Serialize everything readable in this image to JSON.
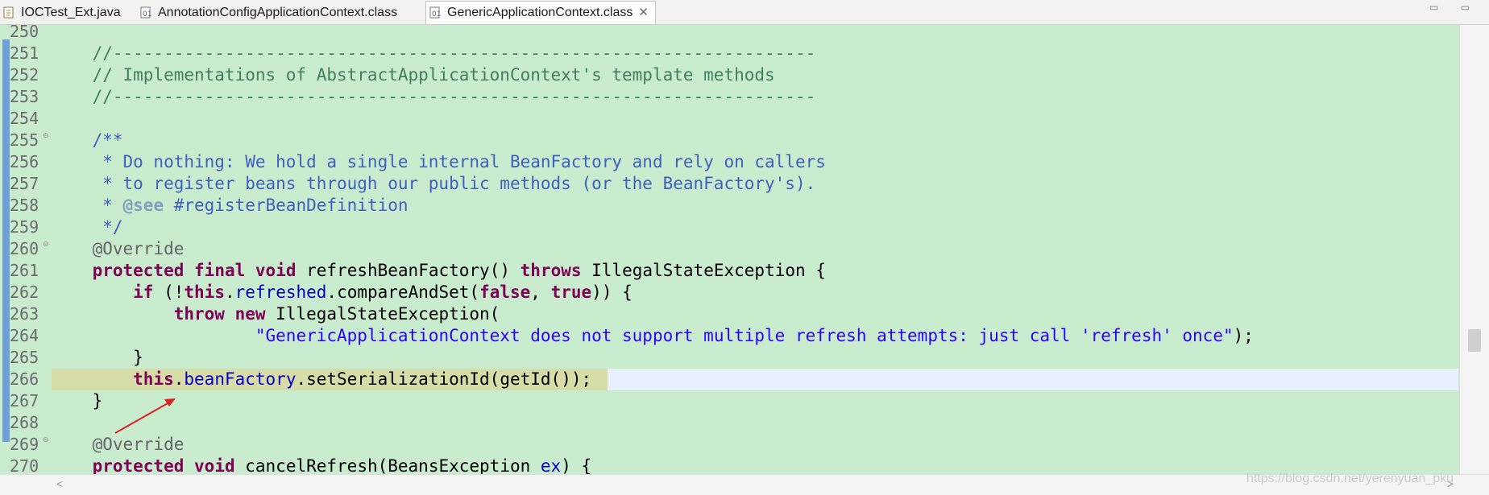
{
  "tabs": [
    {
      "label": "IOCTest_Ext.java",
      "icon": "java-file-icon",
      "active": false
    },
    {
      "label": "AnnotationConfigApplicationContext.class",
      "icon": "class-file-icon",
      "active": false
    },
    {
      "label": "GenericApplicationContext.class",
      "icon": "class-file-icon",
      "active": true,
      "close": "✕"
    }
  ],
  "window_buttons": "▭ ▭",
  "editor": {
    "line_numbers": [
      "250",
      "251",
      "252",
      "253",
      "254",
      "255",
      "256",
      "257",
      "258",
      "259",
      "260",
      "261",
      "262",
      "263",
      "264",
      "265",
      "266",
      "267",
      "268",
      "269",
      "270"
    ],
    "current_line": "266",
    "highlighted_text": "this.beanFactory.setSerializationId(getId());",
    "background_color": "#c9eccf",
    "code_lines": [
      {
        "n": "250",
        "tokens": []
      },
      {
        "n": "251",
        "tokens": [
          {
            "t": "    //---------------------------------------------------------------------",
            "c": "comment"
          }
        ]
      },
      {
        "n": "252",
        "tokens": [
          {
            "t": "    // Implementations of AbstractApplicationContext's template methods",
            "c": "comment"
          }
        ]
      },
      {
        "n": "253",
        "tokens": [
          {
            "t": "    //---------------------------------------------------------------------",
            "c": "comment"
          }
        ]
      },
      {
        "n": "254",
        "tokens": []
      },
      {
        "n": "255",
        "tokens": [
          {
            "t": "    /**",
            "c": "doc"
          }
        ]
      },
      {
        "n": "256",
        "tokens": [
          {
            "t": "     * Do nothing: We hold a single internal BeanFactory and rely on callers",
            "c": "doc"
          }
        ]
      },
      {
        "n": "257",
        "tokens": [
          {
            "t": "     * to register beans through our public methods (or the BeanFactory's).",
            "c": "doc"
          }
        ]
      },
      {
        "n": "258",
        "tokens": [
          {
            "t": "     * ",
            "c": "doc"
          },
          {
            "t": "@see",
            "c": "tag"
          },
          {
            "t": " #registerBeanDefinition",
            "c": "doc"
          }
        ]
      },
      {
        "n": "259",
        "tokens": [
          {
            "t": "     */",
            "c": "doc"
          }
        ]
      },
      {
        "n": "260",
        "tokens": [
          {
            "t": "    @Override",
            "c": "ann"
          }
        ]
      },
      {
        "n": "261",
        "tokens": [
          {
            "t": "    ",
            "c": ""
          },
          {
            "t": "protected",
            "c": "kw"
          },
          {
            "t": " ",
            "c": ""
          },
          {
            "t": "final",
            "c": "kw"
          },
          {
            "t": " ",
            "c": ""
          },
          {
            "t": "void",
            "c": "kw"
          },
          {
            "t": " refreshBeanFactory() ",
            "c": ""
          },
          {
            "t": "throws",
            "c": "kw"
          },
          {
            "t": " IllegalStateException {",
            "c": ""
          }
        ]
      },
      {
        "n": "262",
        "tokens": [
          {
            "t": "        ",
            "c": ""
          },
          {
            "t": "if",
            "c": "kw"
          },
          {
            "t": " (!",
            "c": ""
          },
          {
            "t": "this",
            "c": "kw"
          },
          {
            "t": ".",
            "c": ""
          },
          {
            "t": "refreshed",
            "c": "field"
          },
          {
            "t": ".compareAndSet(",
            "c": ""
          },
          {
            "t": "false",
            "c": "kw"
          },
          {
            "t": ", ",
            "c": ""
          },
          {
            "t": "true",
            "c": "kw"
          },
          {
            "t": ")) {",
            "c": ""
          }
        ]
      },
      {
        "n": "263",
        "tokens": [
          {
            "t": "            ",
            "c": ""
          },
          {
            "t": "throw",
            "c": "kw"
          },
          {
            "t": " ",
            "c": ""
          },
          {
            "t": "new",
            "c": "kw"
          },
          {
            "t": " IllegalStateException(",
            "c": ""
          }
        ]
      },
      {
        "n": "264",
        "tokens": [
          {
            "t": "                    ",
            "c": ""
          },
          {
            "t": "\"GenericApplicationContext does not support multiple refresh attempts: just call 'refresh' once\"",
            "c": "str"
          },
          {
            "t": ");",
            "c": ""
          }
        ]
      },
      {
        "n": "265",
        "tokens": [
          {
            "t": "        }",
            "c": ""
          }
        ]
      },
      {
        "n": "266",
        "tokens": [
          {
            "t": "        ",
            "c": ""
          },
          {
            "t": "this",
            "c": "kw"
          },
          {
            "t": ".",
            "c": ""
          },
          {
            "t": "beanFactory",
            "c": "field"
          },
          {
            "t": ".setSerializationId(getId());",
            "c": ""
          }
        ]
      },
      {
        "n": "267",
        "tokens": [
          {
            "t": "    }",
            "c": ""
          }
        ]
      },
      {
        "n": "268",
        "tokens": []
      },
      {
        "n": "269",
        "tokens": [
          {
            "t": "    @Override",
            "c": "ann"
          }
        ]
      },
      {
        "n": "270",
        "tokens": [
          {
            "t": "    ",
            "c": ""
          },
          {
            "t": "protected",
            "c": "kw"
          },
          {
            "t": " ",
            "c": ""
          },
          {
            "t": "void",
            "c": "kw"
          },
          {
            "t": " cancelRefresh(BeansException ",
            "c": ""
          },
          {
            "t": "ex",
            "c": "field"
          },
          {
            "t": ") {",
            "c": ""
          }
        ]
      }
    ]
  },
  "colors": {
    "comment": "#3f7f5f",
    "doc": "#3f5fbf",
    "keyword": "#7f0055",
    "annotation": "#646464",
    "field": "#0000c0",
    "string": "#2a00ff",
    "arrow": "#e02020"
  },
  "watermark": "https://blog.csdn.net/yerenyuan_pku"
}
